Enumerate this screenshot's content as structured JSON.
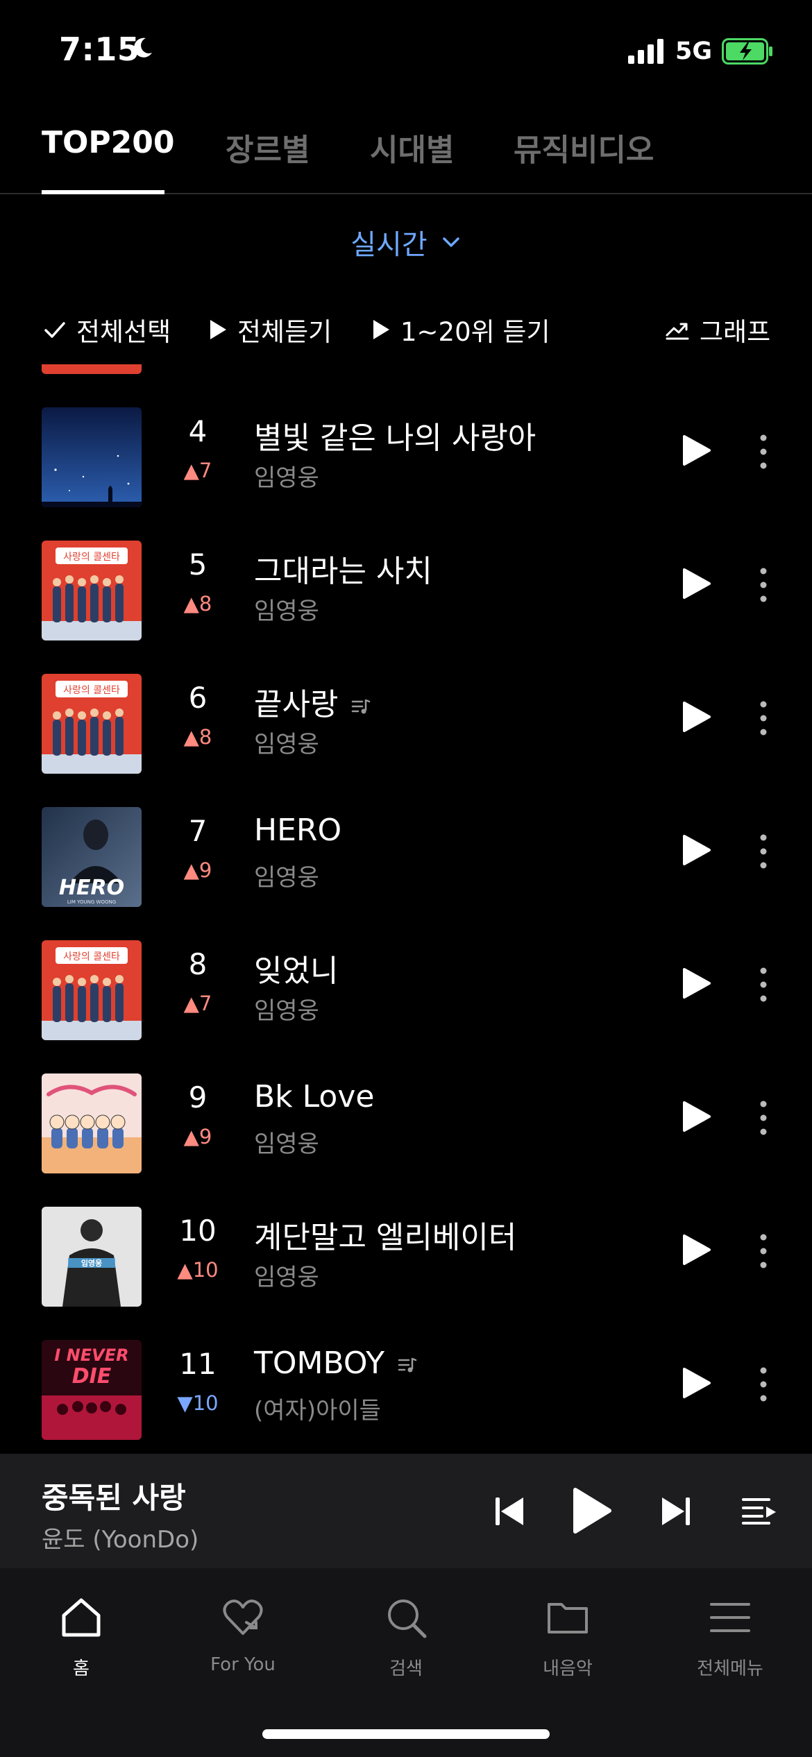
{
  "status_bar": {
    "time": "7:15",
    "network": "5G",
    "icons": [
      "moon-icon",
      "signal-icon",
      "battery-charging-icon"
    ]
  },
  "tabs": [
    {
      "label": "TOP200",
      "active": true
    },
    {
      "label": "장르별",
      "active": false
    },
    {
      "label": "시대별",
      "active": false
    },
    {
      "label": "뮤직비디오",
      "active": false
    }
  ],
  "chart_filter": {
    "label": "실시간"
  },
  "actions": {
    "select_all": "전체선택",
    "play_all": "전체듣기",
    "play_top20": "1~20위 듣기",
    "graph": "그래프"
  },
  "tracks": [
    {
      "rank": "4",
      "delta": "7",
      "direction": "up",
      "title": "별빛 같은 나의 사랑아",
      "artist": "임영웅",
      "lyrics_icon": false,
      "cover": "night-sky"
    },
    {
      "rank": "5",
      "delta": "8",
      "direction": "up",
      "title": "그대라는 사치",
      "artist": "임영웅",
      "lyrics_icon": false,
      "cover": "red-group"
    },
    {
      "rank": "6",
      "delta": "8",
      "direction": "up",
      "title": "끝사랑",
      "artist": "임영웅",
      "lyrics_icon": true,
      "cover": "red-group"
    },
    {
      "rank": "7",
      "delta": "9",
      "direction": "up",
      "title": "HERO",
      "artist": "임영웅",
      "lyrics_icon": false,
      "cover": "hero"
    },
    {
      "rank": "8",
      "delta": "7",
      "direction": "up",
      "title": "잊었니",
      "artist": "임영웅",
      "lyrics_icon": false,
      "cover": "red-group"
    },
    {
      "rank": "9",
      "delta": "9",
      "direction": "up",
      "title": "Bk Love",
      "artist": "임영웅",
      "lyrics_icon": false,
      "cover": "pink-cartoon"
    },
    {
      "rank": "10",
      "delta": "10",
      "direction": "up",
      "title": "계단말고 엘리베이터",
      "artist": "임영웅",
      "lyrics_icon": false,
      "cover": "portrait"
    },
    {
      "rank": "11",
      "delta": "10",
      "direction": "down",
      "title": "TOMBOY",
      "artist": "(여자)아이들",
      "lyrics_icon": true,
      "cover": "never-die"
    }
  ],
  "hero_cover_text": {
    "title": "HERO",
    "subtitle": "LIM YOUNG WOONG"
  },
  "never_die_cover_text": {
    "line1": "I NEVER",
    "line2": "DIE"
  },
  "red_cover_text": "사랑의 콜센타",
  "portrait_cover_text": "임영웅",
  "now_playing": {
    "title": "중독된 사랑",
    "artist": "윤도 (YoonDo)"
  },
  "bottom_nav": [
    {
      "label": "홈",
      "icon": "home-icon",
      "active": true
    },
    {
      "label": "For You",
      "icon": "heart-icon",
      "active": false
    },
    {
      "label": "검색",
      "icon": "search-icon",
      "active": false
    },
    {
      "label": "내음악",
      "icon": "folder-icon",
      "active": false
    },
    {
      "label": "전체메뉴",
      "icon": "menu-icon",
      "active": false
    }
  ],
  "colors": {
    "background": "#000000",
    "accent_blue": "#6ea8ff",
    "rank_up": "#ff8a80",
    "rank_down": "#7aa7ff",
    "mini_player_bg": "#1d1d1f",
    "battery_green": "#4cd964"
  }
}
